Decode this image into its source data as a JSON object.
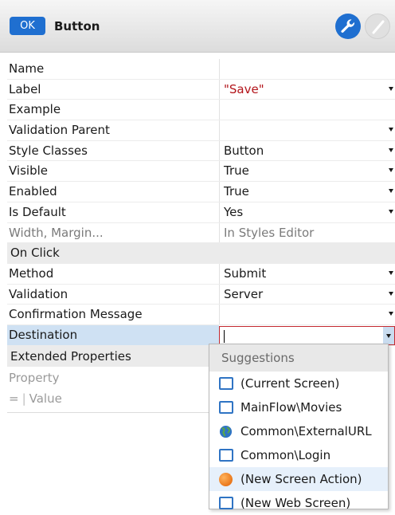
{
  "header": {
    "badge": "OK",
    "title": "Button",
    "icons": [
      "wrench-icon",
      "disabled-toggle-icon"
    ],
    "accent": "#1f6fd0"
  },
  "properties": [
    {
      "label": "Name",
      "value": "",
      "dropdown": false
    },
    {
      "label": "Label",
      "value": "\"Save\"",
      "dropdown": true,
      "value_color": "#b3151b"
    },
    {
      "label": "Example",
      "value": "",
      "dropdown": false
    },
    {
      "label": "Validation Parent",
      "value": "",
      "dropdown": true
    },
    {
      "label": "Style Classes",
      "value": "Button",
      "dropdown": true
    },
    {
      "label": "Visible",
      "value": "True",
      "dropdown": true
    },
    {
      "label": "Enabled",
      "value": "True",
      "dropdown": true
    },
    {
      "label": "Is Default",
      "value": "Yes",
      "dropdown": true
    },
    {
      "label": "Width, Margin...",
      "value": "In Styles Editor",
      "dropdown": false,
      "muted": true
    }
  ],
  "on_click": {
    "section_label": "On Click",
    "rows": [
      {
        "label": "Method",
        "value": "Submit",
        "dropdown": true
      },
      {
        "label": "Validation",
        "value": "Server",
        "dropdown": true
      },
      {
        "label": "Confirmation Message",
        "value": "",
        "dropdown": true
      }
    ],
    "destination": {
      "label": "Destination",
      "value": ""
    }
  },
  "extended": {
    "section_label": "Extended Properties",
    "property_placeholder": "Property",
    "value_prefix": "=",
    "value_placeholder": "Value"
  },
  "suggestions": {
    "header": "Suggestions",
    "items": [
      {
        "label": "(Current Screen)",
        "icon": "screen-icon"
      },
      {
        "label": "MainFlow\\Movies",
        "icon": "screen-icon"
      },
      {
        "label": "Common\\ExternalURL",
        "icon": "globe-icon"
      },
      {
        "label": "Common\\Login",
        "icon": "screen-icon"
      },
      {
        "label": "(New Screen Action)",
        "icon": "screen-action-icon",
        "highlighted": true
      },
      {
        "label": "(New Web Screen)",
        "icon": "screen-icon"
      }
    ]
  }
}
